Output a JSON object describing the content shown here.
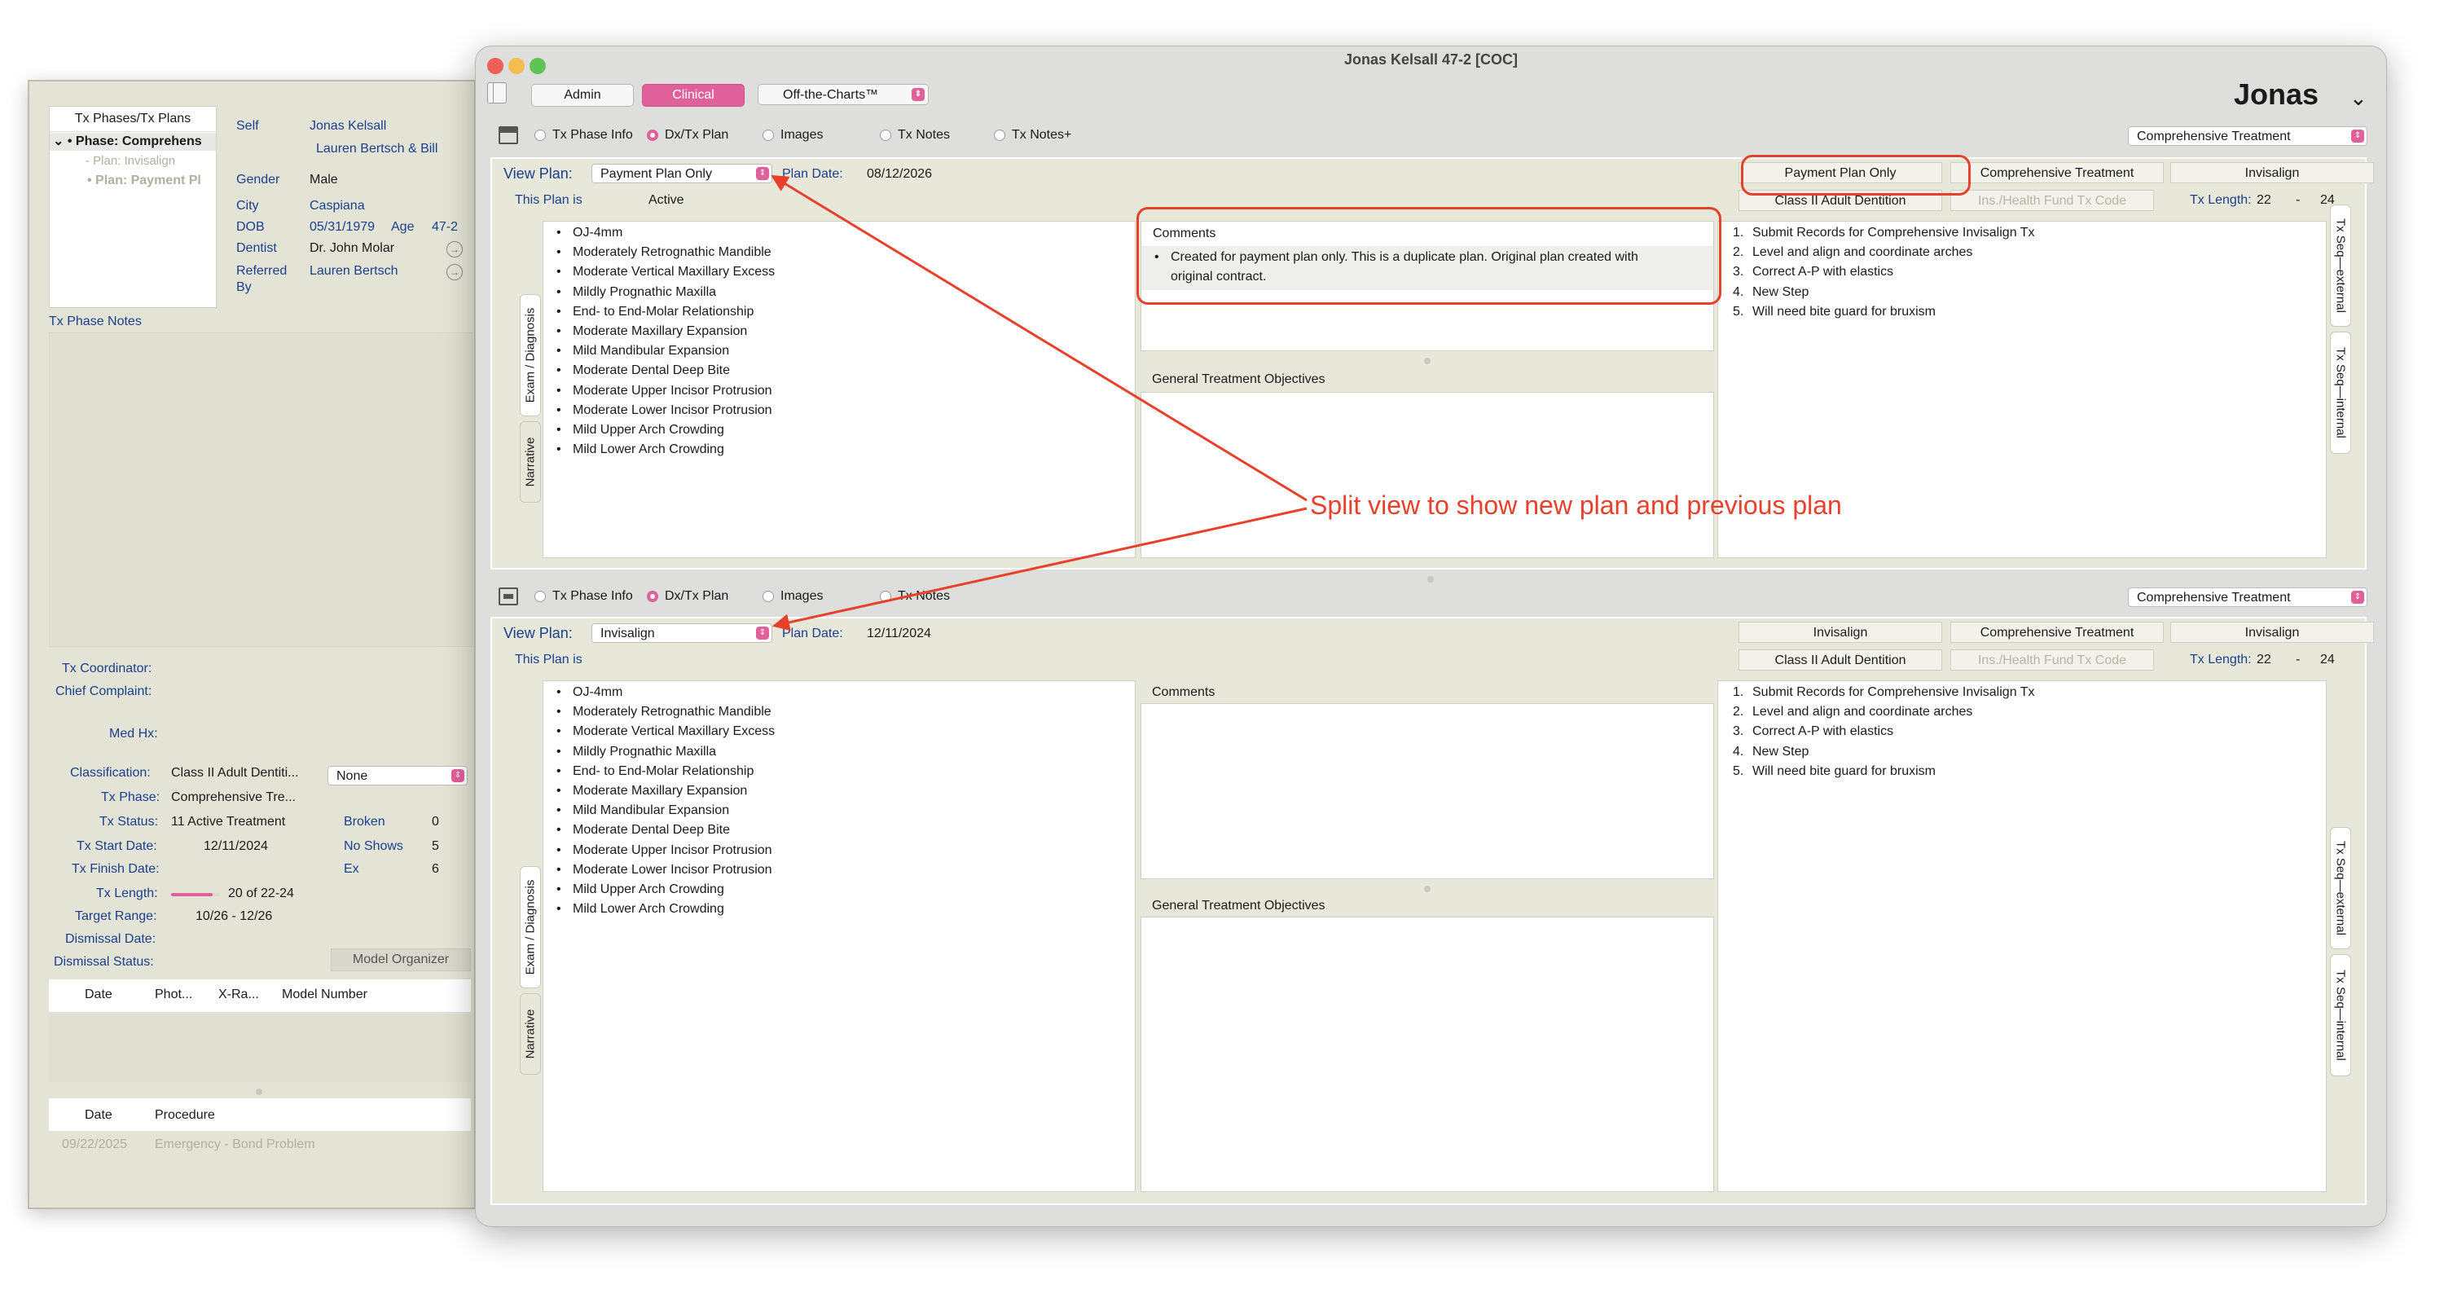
{
  "back_panel": {
    "tree_header": "Tx Phases/Tx Plans",
    "tree_items": [
      "• Phase: Comprehens",
      "- Plan: Invisalign",
      "• Plan: Payment Pl"
    ],
    "patient": {
      "self_label": "Self",
      "self_value": "Jonas Kelsall",
      "responsible": "Lauren Bertsch & Bill",
      "gender_label": "Gender",
      "gender_value": "Male",
      "city_label": "City",
      "city_value": "Caspiana",
      "dob_label": "DOB",
      "dob_value": "05/31/1979",
      "age_label": "Age",
      "age_value": "47-2",
      "dentist_label": "Dentist",
      "dentist_value": "Dr. John Molar",
      "referred_label": "Referred",
      "referred_label2": "By",
      "referred_value": "Lauren Bertsch"
    },
    "tx_phase_notes": "Tx Phase Notes",
    "fields": {
      "coordinator_label": "Tx Coordinator:",
      "complaint_label": "Chief Complaint:",
      "medhx_label": "Med Hx:",
      "classification_label": "Classification:",
      "classification_value": "Class II Adult Dentiti...",
      "none_select": "None",
      "phase_label": "Tx Phase:",
      "phase_value": "Comprehensive Tre...",
      "status_label": "Tx Status:",
      "status_value": "11 Active Treatment",
      "start_label": "Tx Start Date:",
      "start_value": "12/11/2024",
      "finish_label": "Tx Finish Date:",
      "length_label": "Tx Length:",
      "length_value": "20 of 22-24",
      "length_progress": 0.85,
      "target_label": "Target Range:",
      "target_value": "10/26 - 12/26",
      "dismissal_date_label": "Dismissal Date:",
      "dismissal_status_label": "Dismissal Status:",
      "broken_label": "Broken",
      "broken_value": "0",
      "noshows_label": "No Shows",
      "noshows_value": "5",
      "ex_label": "Ex",
      "ex_value": "6",
      "model_organizer": "Model Organizer"
    },
    "models_table": {
      "columns": [
        "Date",
        "Phot...",
        "X-Ra...",
        "Model Number"
      ]
    },
    "procedures_table": {
      "columns": [
        "Date",
        "Procedure"
      ],
      "rows": [
        {
          "date": "09/22/2025",
          "procedure": "Emergency - Bond Problem"
        }
      ]
    }
  },
  "main_window": {
    "title": "Jonas Kelsall 47-2 [COC]",
    "tabs": [
      "Admin",
      "Clinical",
      "Off-the-Charts™"
    ],
    "active_tab": "Clinical",
    "patient_first_name": "Jonas",
    "colors": {
      "accent": "#e0609a",
      "annotation": "#e8402a",
      "label_blue": "#1a3f8f"
    },
    "upper": {
      "radios": [
        "Tx Phase Info",
        "Dx/Tx Plan",
        "Images",
        "Tx Notes",
        "Tx Notes+"
      ],
      "selected_radio": "Dx/Tx Plan",
      "phase_select": "Comprehensive Treatment",
      "view_plan_label": "View Plan:",
      "view_plan_value": "Payment Plan Only",
      "plan_date_label": "Plan Date:",
      "plan_date_value": "08/12/2026",
      "plan_is_label": "This Plan is",
      "plan_is_value": "Active",
      "buttons": [
        "Payment Plan Only",
        "Comprehensive Treatment",
        "Invisalign",
        "Class II Adult Dentition",
        "Ins./Health Fund Tx Code"
      ],
      "tx_length_label": "Tx Length:",
      "tx_length_min": "22",
      "tx_length_dash": "-",
      "tx_length_max": "24",
      "diagnosis": [
        "OJ-4mm",
        "Moderately Retrognathic Mandible",
        "Moderate Vertical Maxillary Excess",
        "Mildly Prognathic Maxilla",
        "End- to End-Molar Relationship",
        "Moderate Maxillary Expansion",
        "Mild Mandibular Expansion",
        "Moderate Dental Deep Bite",
        "Moderate Upper Incisor Protrusion",
        "Moderate Lower Incisor Protrusion",
        "Mild Upper Arch Crowding",
        "Mild Lower Arch Crowding"
      ],
      "comments_label": "Comments",
      "comment_line1": "Created for payment plan only. This is a duplicate plan. Original plan created with",
      "comment_line2": "original contract.",
      "objectives_label": "General Treatment Objectives",
      "steps": [
        "Submit Records for Comprehensive Invisalign Tx",
        "Level and align and coordinate arches",
        "Correct A-P with elastics",
        "New Step",
        "Will need bite guard for bruxism"
      ],
      "side_tabs_left": [
        "Exam / Diagnosis",
        "Narrative"
      ],
      "side_tabs_right": [
        "Tx Seq—external",
        "Tx Seq—internal"
      ]
    },
    "lower": {
      "radios": [
        "Tx Phase Info",
        "Dx/Tx Plan",
        "Images",
        "Tx Notes"
      ],
      "selected_radio": "Dx/Tx Plan",
      "phase_select": "Comprehensive Treatment",
      "view_plan_label": "View Plan:",
      "view_plan_value": "Invisalign",
      "plan_date_label": "Plan Date:",
      "plan_date_value": "12/11/2024",
      "plan_is_label": "This Plan is",
      "buttons": [
        "Invisalign",
        "Comprehensive Treatment",
        "Invisalign",
        "Class II Adult Dentition",
        "Ins./Health Fund Tx Code"
      ],
      "tx_length_label": "Tx Length:",
      "tx_length_min": "22",
      "tx_length_dash": "-",
      "tx_length_max": "24",
      "diagnosis": [
        "OJ-4mm",
        "Moderately Retrognathic Mandible",
        "Moderate Vertical Maxillary Excess",
        "Mildly Prognathic Maxilla",
        "End- to End-Molar Relationship",
        "Moderate Maxillary Expansion",
        "Mild Mandibular Expansion",
        "Moderate Dental Deep Bite",
        "Moderate Upper Incisor Protrusion",
        "Moderate Lower Incisor Protrusion",
        "Mild Upper Arch Crowding",
        "Mild Lower Arch Crowding"
      ],
      "comments_label": "Comments",
      "objectives_label": "General Treatment Objectives",
      "steps": [
        "Submit Records for Comprehensive Invisalign Tx",
        "Level and align and coordinate arches",
        "Correct A-P with elastics",
        "New Step",
        "Will need bite guard for bruxism"
      ],
      "side_tabs_left": [
        "Exam / Diagnosis",
        "Narrative"
      ],
      "side_tabs_right": [
        "Tx Seq—external",
        "Tx Seq—internal"
      ]
    }
  },
  "annotation": {
    "text": "Split view to show new plan and previous plan"
  }
}
